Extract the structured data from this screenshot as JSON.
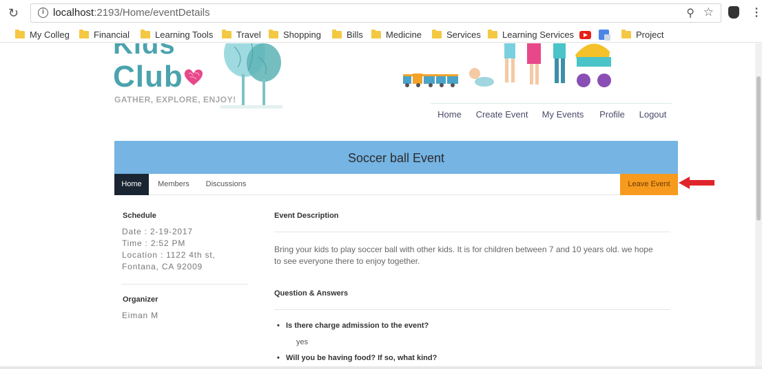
{
  "browser": {
    "url_host": "localhost",
    "url_path": ":2193/Home/eventDetails",
    "bookmarks": [
      {
        "label": "My Colleg"
      },
      {
        "label": "Financial"
      },
      {
        "label": "Learning Tools"
      },
      {
        "label": "Travel"
      },
      {
        "label": "Shopping"
      },
      {
        "label": "Bills"
      },
      {
        "label": "Medicine"
      },
      {
        "label": "Services"
      },
      {
        "label": "Learning Services"
      },
      {
        "label": "Project"
      }
    ],
    "overflow": "»"
  },
  "site": {
    "logo_line1": "Kids",
    "logo_line2": "Club",
    "tagline": "GATHER, EXPLORE, ENJOY!",
    "nav": [
      "Home",
      "Create Event",
      "My Events",
      "Profile",
      "Logout"
    ]
  },
  "event": {
    "title": "Soccer ball Event",
    "tabs": [
      "Home",
      "Members",
      "Discussions"
    ],
    "leave_label": "Leave Event",
    "schedule_heading": "Schedule",
    "date": "Date : 2-19-2017",
    "time": "Time : 2:52 PM",
    "location_line1": "Location : 1122 4th st,",
    "location_line2": "Fontana, CA 92009",
    "organizer_heading": "Organizer",
    "organizer": "Eiman M",
    "description_heading": "Event Description",
    "description": "Bring your kids to play soccer ball with other kids. It is for children between 7 and 10 years old. we hope to see everyone there to enjoy together.",
    "qa_heading": "Question & Answers",
    "qa": [
      {
        "question": "Is there charge admission to the event?",
        "answer": "yes"
      },
      {
        "question": "Will you be having food? If so, what kind?",
        "answer": ""
      }
    ]
  },
  "colors": {
    "banner": "#75b4e3",
    "leave_button": "#f79a1e",
    "logo": "#4ba3ad",
    "active_tab": "#1a2533",
    "arrow": "#e0242b"
  }
}
